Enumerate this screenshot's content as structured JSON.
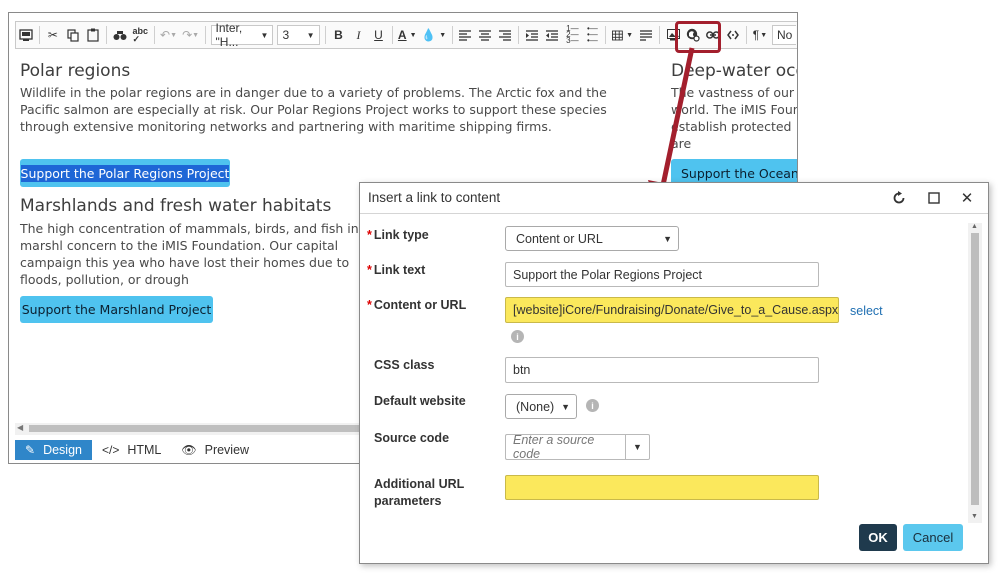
{
  "toolbar": {
    "font_family": "Inter, \"H...",
    "font_size": "3",
    "bold": "B",
    "italic": "I",
    "underline": "U",
    "font_color": "A",
    "paragraph": "¶",
    "format": "No"
  },
  "content": {
    "sections": [
      {
        "heading": "Polar regions",
        "body": "Wildlife in the polar regions are in danger due to a variety of problems. The Arctic fox and the Pacific salmon are especially at risk. Our Polar Regions Project works to support these species through extensive monitoring networks and partnering with maritime shipping firms.",
        "button": "Support the Polar Regions Project"
      },
      {
        "heading": "Deep-water oceans",
        "body": "The vastness of our pl world. The iMIS Found establish protected are",
        "button": "Support the Oceans"
      },
      {
        "heading": "Marshlands and fresh water habitats",
        "body": "The high concentration of mammals, birds, and fish in marshl concern to the iMIS Foundation. Our capital campaign this yea who have lost their homes due to floods, pollution, or drough",
        "button": "Support the Marshland Project"
      }
    ]
  },
  "modes": {
    "design": "Design",
    "html": "HTML",
    "preview": "Preview"
  },
  "dialog": {
    "title": "Insert a link to content",
    "fields": {
      "link_type": {
        "label": "Link type",
        "value": "Content or URL"
      },
      "link_text": {
        "label": "Link text",
        "value": "Support the Polar Regions Project"
      },
      "content_url": {
        "label": "Content or URL",
        "value": "[website]iCore/Fundraising/Donate/Give_to_a_Cause.aspx",
        "select_link": "select"
      },
      "css_class": {
        "label": "CSS class",
        "value": "btn"
      },
      "default_website": {
        "label": "Default website",
        "value": "(None)"
      },
      "source_code": {
        "label": "Source code",
        "placeholder": "Enter a source code"
      },
      "additional_url": {
        "label_line1": "Additional URL",
        "label_line2": "parameters",
        "value": ""
      }
    },
    "ok_label": "OK",
    "cancel_label": "Cancel"
  },
  "colors": {
    "button_blue": "#4fc3ef",
    "selection_blue": "#1e66d6",
    "highlight_yellow": "#fbe85c",
    "annotation_red": "#a31f2d",
    "ok_dark": "#1f3a4d",
    "design_tab": "#2f86c9"
  },
  "icons": [
    "save-icon",
    "cut-icon",
    "copy-icon",
    "paste-icon",
    "find-icon",
    "spellcheck-icon",
    "undo-icon",
    "redo-icon",
    "align-left-icon",
    "align-center-icon",
    "align-right-icon",
    "indent-icon",
    "outdent-icon",
    "ordered-list-icon",
    "bullet-list-icon",
    "table-icon",
    "image-icon",
    "link-to-content-icon",
    "hyperlink-icon",
    "unlink-icon",
    "refresh-icon",
    "maximize-icon",
    "close-icon",
    "info-icon",
    "pencil-icon",
    "code-icon",
    "eye-icon"
  ]
}
